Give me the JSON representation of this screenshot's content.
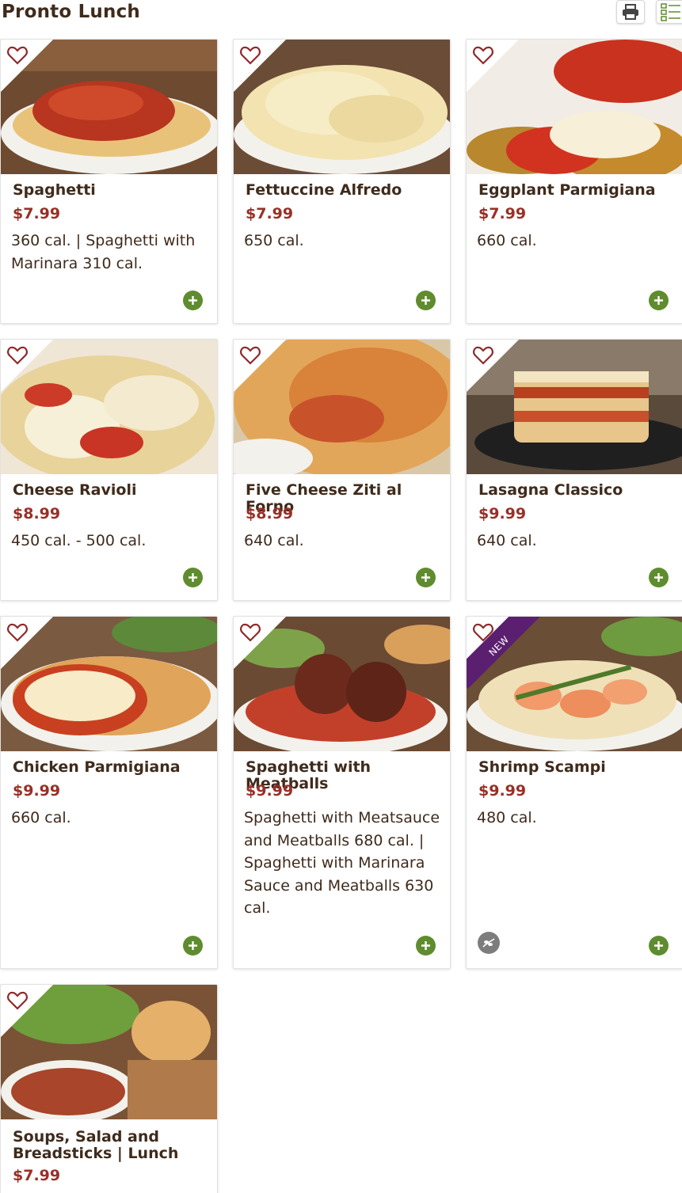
{
  "page": {
    "title": "Pronto Lunch"
  },
  "toolbar": {
    "print_icon": "printer-icon",
    "view_icon": "list-view-icon"
  },
  "colors": {
    "brand_brown": "#3f2b1c",
    "price_red": "#9a2f27",
    "add_green": "#5f8c2e",
    "new_purple": "#5b1f70"
  },
  "items": [
    {
      "name": "Spaghetti",
      "price": "$7.99",
      "desc": "360 cal. | Spaghetti with Marinara 310 cal."
    },
    {
      "name": "Fettuccine Alfredo",
      "price": "$7.99",
      "desc": "650 cal."
    },
    {
      "name": "Eggplant Parmigiana",
      "price": "$7.99",
      "desc": "660 cal."
    },
    {
      "name": "Cheese Ravioli",
      "price": "$8.99",
      "desc": "450 cal. - 500 cal."
    },
    {
      "name": "Five Cheese Ziti al Forno",
      "price": "$8.99",
      "desc": "640 cal."
    },
    {
      "name": "Lasagna Classico",
      "price": "$9.99",
      "desc": "640 cal."
    },
    {
      "name": "Chicken Parmigiana",
      "price": "$9.99",
      "desc": "660 cal."
    },
    {
      "name": "Spaghetti with Meatballs",
      "price": "$9.99",
      "desc": "Spaghetti with Meatsauce and Meatballs 680 cal. | Spaghetti with Marinara Sauce and Meatballs 630 cal."
    },
    {
      "name": "Shrimp Scampi",
      "price": "$9.99",
      "desc": "480 cal.",
      "badge": "NEW",
      "badge_icon": "olive-branch-icon"
    },
    {
      "name": "Soups, Salad and Breadsticks | Lunch",
      "price": "$7.99",
      "desc": ""
    }
  ]
}
